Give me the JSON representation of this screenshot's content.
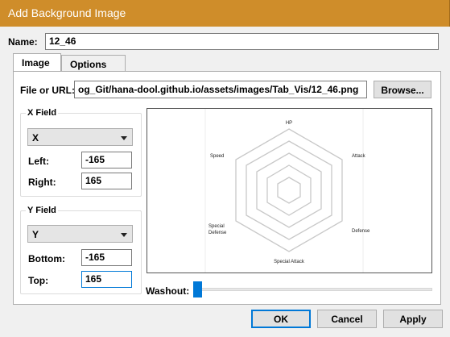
{
  "window": {
    "title": "Add Background Image"
  },
  "name_field": {
    "label": "Name:",
    "value": "12_46"
  },
  "tabs": [
    {
      "label": "Image"
    },
    {
      "label": "Options"
    }
  ],
  "file": {
    "label": "File or URL:",
    "value": "og_Git/hana-dool.github.io/assets/images/Tab_Vis/12_46.png",
    "browse_label": "Browse..."
  },
  "x_field": {
    "group_label": "X Field",
    "selected": "X",
    "left_label": "Left:",
    "left_value": "-165",
    "right_label": "Right:",
    "right_value": "165"
  },
  "y_field": {
    "group_label": "Y Field",
    "selected": "Y",
    "bottom_label": "Bottom:",
    "bottom_value": "-165",
    "top_label": "Top:",
    "top_value": "165"
  },
  "preview": {
    "axes": [
      "HP",
      "Attack",
      "Defense",
      "Special Attack",
      "Special Defense",
      "Speed"
    ],
    "special_defense_lines": [
      "Special",
      "Defense"
    ]
  },
  "washout": {
    "label": "Washout:",
    "value": 0
  },
  "buttons": {
    "ok": "OK",
    "cancel": "Cancel",
    "apply": "Apply"
  }
}
